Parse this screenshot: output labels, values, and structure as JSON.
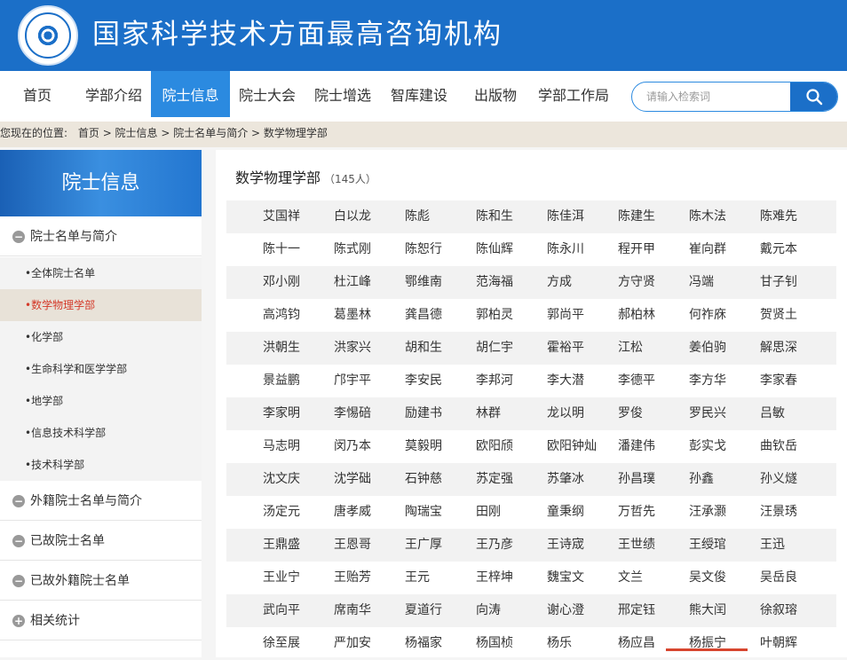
{
  "header": {
    "site_title": "国家科学技术方面最高咨询机构"
  },
  "nav": {
    "items": [
      "首页",
      "学部介绍",
      "院士信息",
      "院士大会",
      "院士增选",
      "智库建设",
      "出版物",
      "学部工作局"
    ],
    "active": 2,
    "search_placeholder": "请输入检索词"
  },
  "breadcrumb": {
    "prefix": "您现在的位置:",
    "path": "首页 > 院士信息 > 院士名单与简介 > 数学物理学部"
  },
  "sidebar": {
    "title": "院士信息",
    "sections": [
      {
        "label": "院士名单与简介",
        "symbol": "−"
      },
      {
        "label": "外籍院士名单与简介",
        "symbol": "−"
      },
      {
        "label": "已故院士名单",
        "symbol": "−"
      },
      {
        "label": "已故外籍院士名单",
        "symbol": "−"
      },
      {
        "label": "相关统计",
        "symbol": "+"
      }
    ],
    "subitems": [
      "•全体院士名单",
      "•数学物理学部",
      "•化学部",
      "•生命科学和医学学部",
      "•地学部",
      "•信息技术科学部",
      "•技术科学部"
    ],
    "active_sub": 1
  },
  "main": {
    "title": "数学物理学部",
    "count": "（145人）",
    "rows": [
      [
        "艾国祥",
        "白以龙",
        "陈彪",
        "陈和生",
        "陈佳洱",
        "陈建生",
        "陈木法",
        "陈难先"
      ],
      [
        "陈十一",
        "陈式刚",
        "陈恕行",
        "陈仙辉",
        "陈永川",
        "程开甲",
        "崔向群",
        "戴元本"
      ],
      [
        "邓小刚",
        "杜江峰",
        "鄂维南",
        "范海福",
        "方成",
        "方守贤",
        "冯端",
        "甘子钊"
      ],
      [
        "高鸿钧",
        "葛墨林",
        "龚昌德",
        "郭柏灵",
        "郭尚平",
        "郝柏林",
        "何祚庥",
        "贺贤土"
      ],
      [
        "洪朝生",
        "洪家兴",
        "胡和生",
        "胡仁宇",
        "霍裕平",
        "江松",
        "姜伯驹",
        "解思深"
      ],
      [
        "景益鹏",
        "邝宇平",
        "李安民",
        "李邦河",
        "李大潜",
        "李德平",
        "李方华",
        "李家春"
      ],
      [
        "李家明",
        "李惕碚",
        "励建书",
        "林群",
        "龙以明",
        "罗俊",
        "罗民兴",
        "吕敏"
      ],
      [
        "马志明",
        "闵乃本",
        "莫毅明",
        "欧阳颀",
        "欧阳钟灿",
        "潘建伟",
        "彭实戈",
        "曲钦岳"
      ],
      [
        "沈文庆",
        "沈学础",
        "石钟慈",
        "苏定强",
        "苏肇冰",
        "孙昌璞",
        "孙鑫",
        "孙义燧"
      ],
      [
        "汤定元",
        "唐孝威",
        "陶瑞宝",
        "田刚",
        "童秉纲",
        "万哲先",
        "汪承灏",
        "汪景琇"
      ],
      [
        "王鼎盛",
        "王恩哥",
        "王广厚",
        "王乃彦",
        "王诗宬",
        "王世绩",
        "王绶琯",
        "王迅"
      ],
      [
        "王业宁",
        "王贻芳",
        "王元",
        "王梓坤",
        "魏宝文",
        "文兰",
        "吴文俊",
        "吴岳良"
      ],
      [
        "武向平",
        "席南华",
        "夏道行",
        "向涛",
        "谢心澄",
        "邢定钰",
        "熊大闰",
        "徐叙瑢"
      ],
      [
        "徐至展",
        "严加安",
        "杨福家",
        "杨国桢",
        "杨乐",
        "杨应昌",
        "杨振宁",
        "叶朝辉"
      ]
    ]
  },
  "colors": {
    "brand": "#1b6fc8",
    "active_nav": "#2b8ae0",
    "active_sub_text": "#d43a2a",
    "underline": "#d7462f"
  }
}
